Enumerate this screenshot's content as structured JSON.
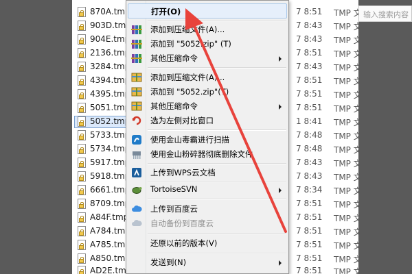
{
  "explorer": {
    "search_placeholder": "输入搜索内容",
    "files": [
      {
        "name": "870A.tmp",
        "time": "7 8:51",
        "type": "TMP 文"
      },
      {
        "name": "903D.tmp",
        "time": "7 8:43",
        "type": "TMP 文"
      },
      {
        "name": "904E.tmp",
        "time": "7 8:43",
        "type": "TMP 文"
      },
      {
        "name": "2136.tmp",
        "time": "7 8:51",
        "type": "TMP 文"
      },
      {
        "name": "3284.tmp",
        "time": "7 8:43",
        "type": "TMP 文"
      },
      {
        "name": "4394.tmp",
        "time": "7 8:51",
        "type": "TMP 文"
      },
      {
        "name": "4395.tmp",
        "time": "7 8:51",
        "type": "TMP 文"
      },
      {
        "name": "5051.tmp",
        "time": "7 8:51",
        "type": "TMP 文"
      },
      {
        "name": "5052.tmp",
        "time": "1 8:41",
        "type": "TMP 文"
      },
      {
        "name": "5733.tmp",
        "time": "7 8:48",
        "type": "TMP 文"
      },
      {
        "name": "5734.tmp",
        "time": "7 8:48",
        "type": "TMP 文"
      },
      {
        "name": "5917.tmp",
        "time": "7 8:43",
        "type": "TMP 文"
      },
      {
        "name": "5918.tmp",
        "time": "7 8:43",
        "type": "TMP 文"
      },
      {
        "name": "6661.tmp",
        "time": "7 8:34",
        "type": "TMP 文"
      },
      {
        "name": "8709.tmp",
        "time": "7 8:51",
        "type": "TMP 文"
      },
      {
        "name": "A84F.tmp",
        "time": "7 8:51",
        "type": "TMP 文"
      },
      {
        "name": "A784.tmp",
        "time": "7 8:51",
        "type": "TMP 文"
      },
      {
        "name": "A785.tmp",
        "time": "7 8:51",
        "type": "TMP 文"
      },
      {
        "name": "A850.tmp",
        "time": "7 8:51",
        "type": "TMP 文"
      },
      {
        "name": "AD2E.tmp",
        "time": "7 8:51",
        "type": "TMP 文"
      }
    ]
  },
  "context_menu": {
    "items": [
      {
        "label": "打开(O)",
        "icon": "none",
        "bold": true,
        "highlighted": true
      },
      {
        "label": "添加到压缩文件(A)...",
        "icon": "winrar-icon"
      },
      {
        "label": "添加到 \"5052.zip\" (T)",
        "icon": "winrar-icon"
      },
      {
        "label": "其他压缩命令",
        "icon": "winrar-icon",
        "submenu": true
      },
      {
        "label": "添加到压缩文件(A)...",
        "icon": "archive-icon"
      },
      {
        "label": "添加到 \"5052.zip\"(T)",
        "icon": "archive-icon"
      },
      {
        "label": "其他压缩命令",
        "icon": "archive-icon",
        "submenu": true
      },
      {
        "label": "选为左侧对比窗口",
        "icon": "compare-icon"
      },
      {
        "label": "使用金山毒霸进行扫描",
        "icon": "duba-icon"
      },
      {
        "label": "使用金山粉碎器彻底删除文件",
        "icon": "shredder-icon"
      },
      {
        "label": "上传到WPS云文档",
        "icon": "wps-cloud-icon"
      },
      {
        "label": "TortoiseSVN",
        "icon": "tortoisesvn-icon",
        "submenu": true
      },
      {
        "label": "上传到百度云",
        "icon": "baidu-cloud-icon"
      },
      {
        "label": "自动备份到百度云",
        "icon": "baidu-backup-icon",
        "disabled": true
      },
      {
        "label": "还原以前的版本(V)",
        "icon": "none"
      },
      {
        "label": "发送到(N)",
        "icon": "none",
        "submenu": true
      }
    ]
  },
  "annotation": {
    "arrow_color": "#e8433c"
  },
  "colors": {
    "selection": "#dbe9fb",
    "menu_bg": "#f0f0f0",
    "surround": "#5a5a5a"
  }
}
